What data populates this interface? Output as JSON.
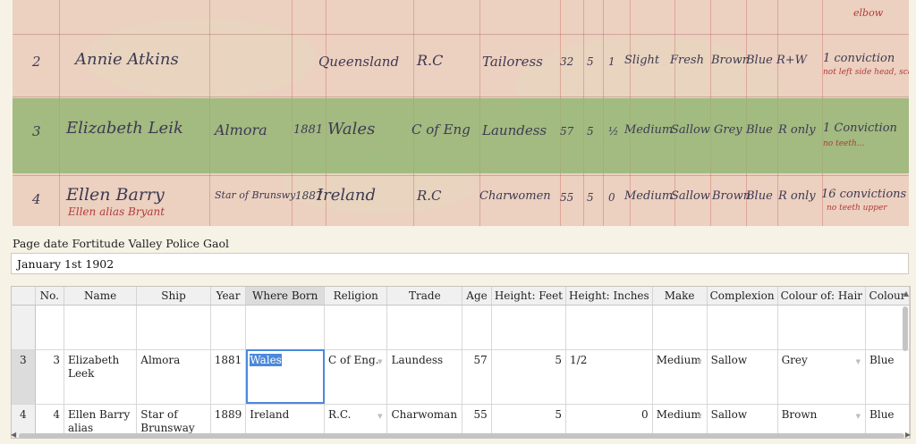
{
  "scan": {
    "top_note": "elbow",
    "rows": [
      {
        "no": "2",
        "name": "Annie Atkins",
        "ship": "",
        "year": "",
        "born": "Queensland",
        "religion": "R.C",
        "trade": "Tailoress",
        "age": "32",
        "feet": "5",
        "inches": "1",
        "make": "Slight",
        "complexion": "Fresh",
        "hair": "Brown",
        "eyes": "Blue",
        "other": "R+W",
        "remarks": "1 conviction",
        "marks": "not left side head, scar... forefinger right"
      },
      {
        "no": "3",
        "name": "Elizabeth Leik",
        "ship": "Almora",
        "year": "1881",
        "born": "Wales",
        "religion": "C of Eng",
        "trade": "Laundess",
        "age": "57",
        "feet": "5",
        "inches": "½",
        "make": "Medium",
        "complexion": "Sallow",
        "hair": "Grey",
        "eyes": "Blue",
        "other": "R only",
        "remarks": "1 Conviction",
        "marks": "no teeth..."
      },
      {
        "no": "4",
        "name": "Ellen Barry",
        "ship": "Star of Brunswy",
        "year": "1887",
        "born": "Ireland",
        "religion": "R.C",
        "trade": "Charwomen",
        "age": "55",
        "feet": "5",
        "inches": "0",
        "make": "Medium",
        "complexion": "Sallow",
        "hair": "Brown",
        "eyes": "Blue",
        "other": "R only",
        "remarks": "16 convictions",
        "marks": "no teeth upper"
      },
      {
        "alias_line": "Ellen alias Bryant"
      }
    ]
  },
  "page_date": {
    "label": "Page date Fortitude Valley Police Gaol",
    "value": "January 1st 1902"
  },
  "table": {
    "columns": [
      "No.",
      "Name",
      "Ship",
      "Year",
      "Where Born",
      "Religion",
      "Trade",
      "Age",
      "Height: Feet",
      "Height: Inches",
      "Make",
      "Complexion",
      "Colour of: Hair",
      "Colour"
    ],
    "active_column": "Where Born",
    "rows": [
      {
        "row_header": "3",
        "no": "3",
        "name": "Elizabeth Leek",
        "ship": "Almora",
        "year": "1881",
        "born": "Wales",
        "religion": "C of Eng.",
        "trade": "Laundess",
        "age": "57",
        "feet": "5",
        "inches": "1/2",
        "make": "Medium",
        "complexion": "Sallow",
        "hair": "Grey",
        "eyes": "Blue"
      },
      {
        "row_header": "4",
        "no": "4",
        "name": "Ellen Barry alias",
        "ship": "Star of Brunsway",
        "year": "1889",
        "born": "Ireland",
        "religion": "R.C.",
        "trade": "Charwoman",
        "age": "55",
        "feet": "5",
        "inches": "0",
        "make": "Medium",
        "complexion": "Sallow",
        "hair": "Brown",
        "eyes": "Blue"
      }
    ]
  },
  "colors": {
    "accent": "#4b89dc",
    "highlight_band": "#8eb46e",
    "paper": "#ecd0c0"
  }
}
